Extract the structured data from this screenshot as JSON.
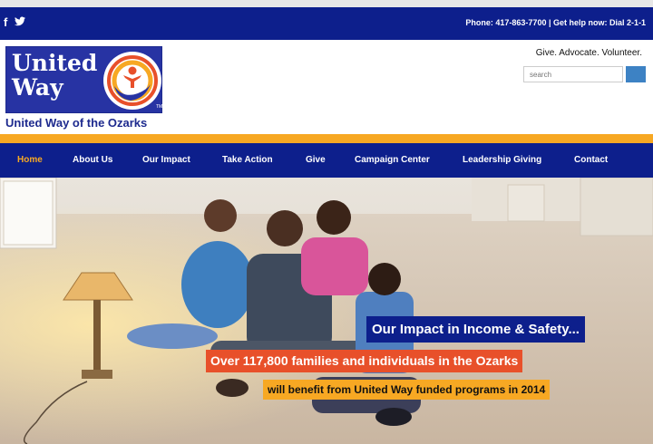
{
  "social": {
    "facebook": "f",
    "twitter": "🐦"
  },
  "utility": {
    "phone": "Phone: 417-863-7700 |  Get help now: Dial 2-1-1"
  },
  "logo": {
    "line1": "United",
    "line2": "Way",
    "sub": "United Way of the Ozarks"
  },
  "tagline": "Give. Advocate. Volunteer.",
  "search": {
    "placeholder": "search"
  },
  "nav": {
    "items": [
      {
        "label": "Home"
      },
      {
        "label": "About Us"
      },
      {
        "label": "Our Impact"
      },
      {
        "label": "Take Action"
      },
      {
        "label": "Give"
      },
      {
        "label": "Campaign Center"
      },
      {
        "label": "Leadership Giving"
      },
      {
        "label": "Contact"
      }
    ],
    "active_color": "#f7a823"
  },
  "hero": {
    "caption1": "Our Impact in Income & Safety...",
    "caption2": "Over 117,800 families and individuals in the Ozarks",
    "caption3": "will benefit from United Way funded programs in 2014"
  },
  "colors": {
    "navy": "#0d1f8c",
    "orange": "#f7a823",
    "red": "#e8502a"
  }
}
